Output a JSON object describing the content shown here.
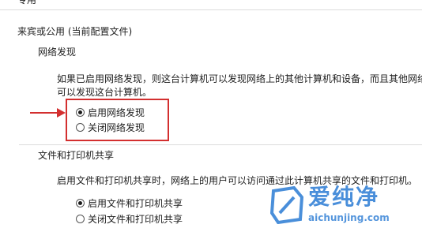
{
  "private_label": "专用",
  "guest_public": {
    "header": "来宾或公用 (当前配置文件)",
    "network_discovery": {
      "title": "网络发现",
      "description_line1": "如果已启用网络发现，则这台计算机可以发现网络上的其他计算机和设备，而且其他网络",
      "description_line2": "可以发现这台计算机。",
      "options": [
        {
          "label": "启用网络发现",
          "selected": true
        },
        {
          "label": "关闭网络发现",
          "selected": false
        }
      ]
    },
    "file_printer_sharing": {
      "title": "文件和打印机共享",
      "description_line1": "启用文件和打印机共享时，网络上的用户可以访问通过此计算机共享的文件和打印机。",
      "options": [
        {
          "label": "启用文件和打印机共享",
          "selected": true
        },
        {
          "label": "关闭文件和打印机共享",
          "selected": false
        }
      ]
    }
  },
  "colors": {
    "highlight": "#d32f2f",
    "watermark": "#2a7bd4"
  },
  "icons": {
    "annotation_arrow": "arrow-right-icon",
    "watermark_logo": "aichunjing-logo-icon"
  },
  "watermark": {
    "text": "爱纯净",
    "url": "aichunjing.com"
  }
}
